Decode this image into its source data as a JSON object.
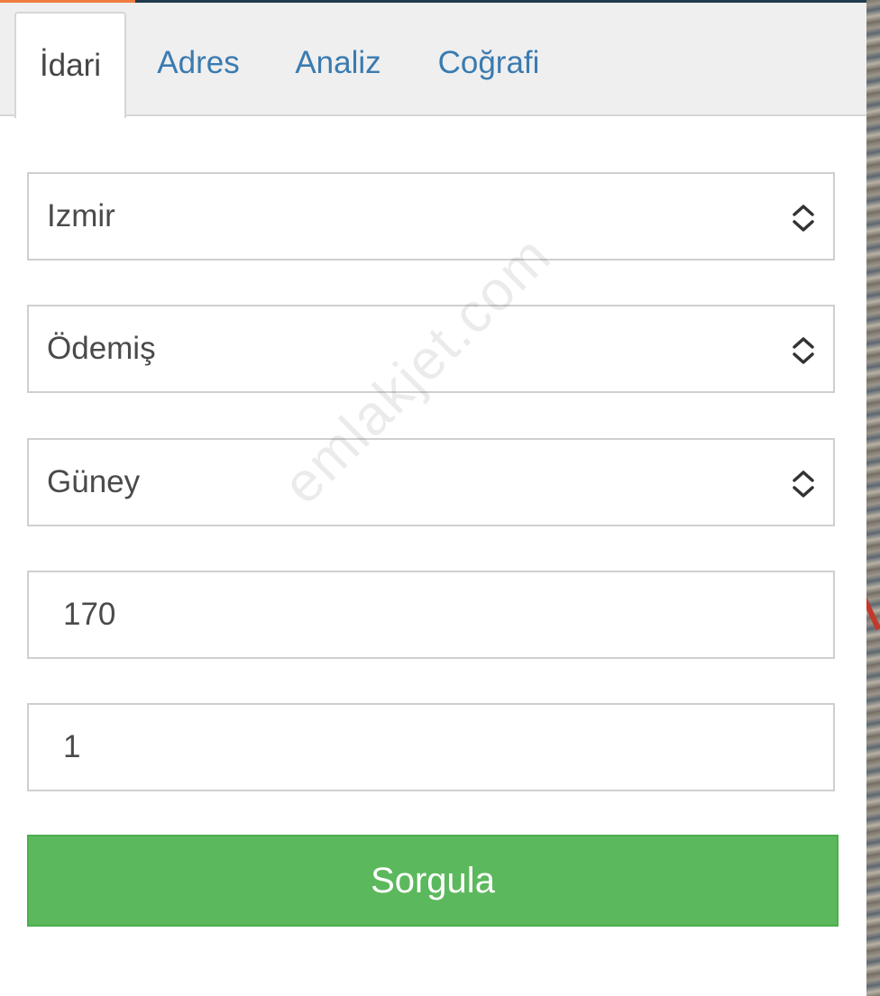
{
  "tabs": [
    {
      "label": "İdari"
    },
    {
      "label": "Adres"
    },
    {
      "label": "Analiz"
    },
    {
      "label": "Coğrafi"
    }
  ],
  "form": {
    "province": "Izmir",
    "district": "Ödemiş",
    "neighborhood": "Güney",
    "block": "170",
    "parcel": "1",
    "submit_label": "Sorgula"
  },
  "watermark": "emlakjet.com",
  "colors": {
    "submit_bg": "#5cb85c",
    "tab_link": "#3a7bb0",
    "top_accent": "#f07b3f"
  }
}
